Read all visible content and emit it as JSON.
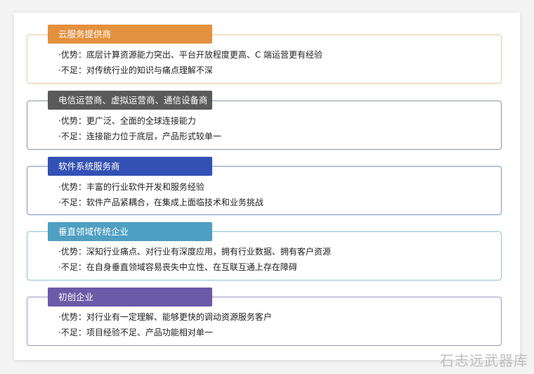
{
  "colors": {
    "group_1": "#e3913f",
    "group_1_border": "#f0c898",
    "group_2": "#5a5a5a",
    "group_2_border": "#8c96a6",
    "group_3": "#3351b4",
    "group_3_border": "#7f94c7",
    "group_4": "#4f9fc2",
    "group_4_border": "#8cc3db",
    "group_5": "#6a5aa8",
    "group_5_border": "#9f96c8"
  },
  "groups": [
    {
      "title": "云服务提供商",
      "advantage": "·优势：底层计算资源能力突出、平台开放程度更高、C 端运营更有经验",
      "disadvantage": "·不足：对传统行业的知识与痛点理解不深"
    },
    {
      "title": "电信运营商、虚拟运营商、通信设备商",
      "advantage": "·优势：更广泛、全面的全球连接能力",
      "disadvantage": "·不足：连接能力位于底层，产品形式较单一"
    },
    {
      "title": "软件系统服务商",
      "advantage": "·优势：丰富的行业软件开发和服务经验",
      "disadvantage": "·不足：软件产品紧耦合，在集成上面临技术和业务挑战"
    },
    {
      "title": "垂直领域传统企业",
      "advantage": "·优势：深知行业痛点、对行业有深度应用，拥有行业数据、拥有客户资源",
      "disadvantage": "·不足：在自身垂直领域容易丧失中立性、在互联互通上存在障碍"
    },
    {
      "title": "初创企业",
      "advantage": "·优势：对行业有一定理解、能够更快的调动资源服务客户",
      "disadvantage": "·不足：项目经验不足、产品功能相对单一"
    }
  ],
  "watermark": "石志远武器库"
}
